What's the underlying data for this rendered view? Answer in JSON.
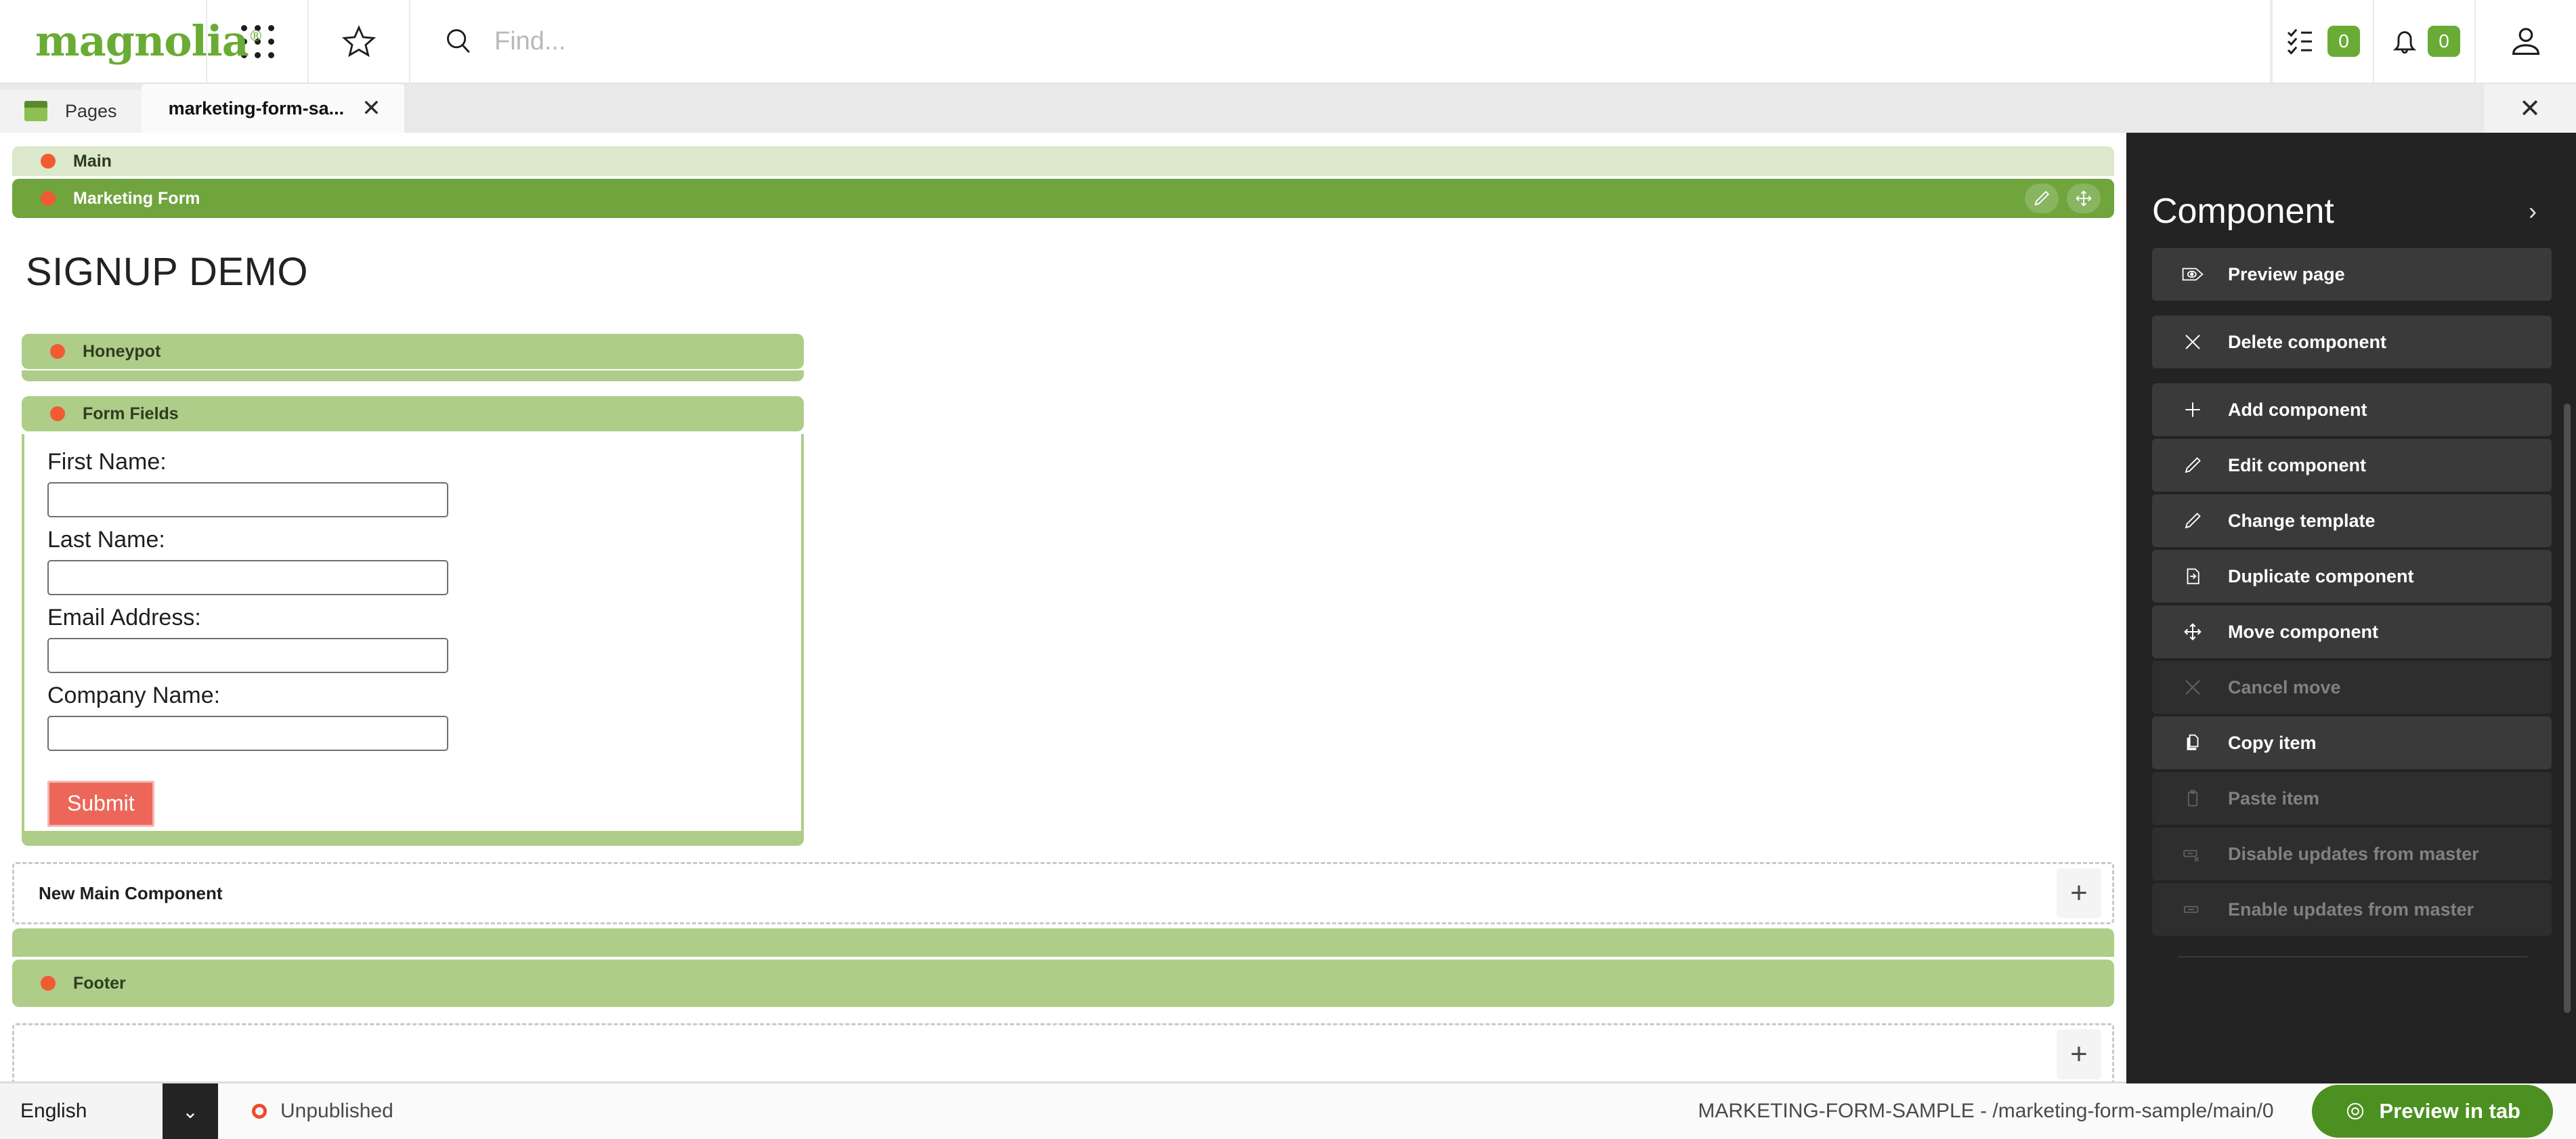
{
  "header": {
    "logo_text": "magnolia",
    "logo_registered": "®",
    "apps_icon": "grid-apps-icon",
    "favorites_icon": "star-icon",
    "search_icon": "search-icon",
    "search_placeholder": "Find...",
    "search_value": "",
    "tasks_icon": "checklist-icon",
    "tasks_count": "0",
    "notifications_icon": "bell-icon",
    "notifications_count": "0",
    "user_icon": "user-avatar-icon",
    "badge_color": "#6aab35"
  },
  "tabs": {
    "pages_tab_label": "Pages",
    "pages_tab_icon": "pages-app-icon",
    "page_tab_label": "marketing-form-sa...",
    "page_tab_close_icon": "close-icon",
    "close_all_icon": "close-icon"
  },
  "editor": {
    "area_main": "Main",
    "component_marketing_form": "Marketing Form",
    "edit_icon": "pencil-icon",
    "move_icon": "move-arrows-icon",
    "page_title": "SIGNUP DEMO",
    "area_honeypot": "Honeypot",
    "area_form_fields": "Form Fields",
    "fields": [
      {
        "label": "First Name:",
        "value": "",
        "name": "first-name"
      },
      {
        "label": "Last Name:",
        "value": "",
        "name": "last-name"
      },
      {
        "label": "Email Address:",
        "value": "",
        "name": "email-address"
      },
      {
        "label": "Company Name:",
        "value": "",
        "name": "company-name"
      }
    ],
    "submit_label": "Submit",
    "submit_color": "#ec6759",
    "new_main_component": "New Main Component",
    "new_main_plus_icon": "plus-icon",
    "area_footer": "Footer",
    "new_footer_plus_icon": "plus-icon",
    "colors": {
      "area_pale": "#dce8cb",
      "component_selected": "#70a43d",
      "area_green": "#aecd88",
      "status_dot": "#f15a33"
    }
  },
  "sidepanel": {
    "title": "Component",
    "collapse_icon": "chevron-right-icon",
    "actions": [
      {
        "label": "Preview page",
        "icon": "preview-eye-tag-icon",
        "disabled": false
      },
      {
        "label": "Delete component",
        "icon": "close-x-icon",
        "disabled": false
      },
      {
        "label": "Add component",
        "icon": "plus-icon",
        "disabled": false
      },
      {
        "label": "Edit component",
        "icon": "pencil-icon",
        "disabled": false
      },
      {
        "label": "Change template",
        "icon": "pencil-icon",
        "disabled": false
      },
      {
        "label": "Duplicate component",
        "icon": "duplicate-icon",
        "disabled": false
      },
      {
        "label": "Move component",
        "icon": "move-arrows-icon",
        "disabled": false
      },
      {
        "label": "Cancel move",
        "icon": "close-x-icon",
        "disabled": true
      },
      {
        "label": "Copy item",
        "icon": "copy-icon",
        "disabled": false
      },
      {
        "label": "Paste item",
        "icon": "clipboard-icon",
        "disabled": true
      },
      {
        "label": "Disable updates from master",
        "icon": "link-off-icon",
        "disabled": true
      },
      {
        "label": "Enable updates from master",
        "icon": "link-icon",
        "disabled": true
      }
    ]
  },
  "statusbar": {
    "language": "English",
    "language_caret_icon": "chevron-down-icon",
    "publication_status": "Unpublished",
    "publication_status_color": "#f1492b",
    "path": "MARKETING-FORM-SAMPLE - /marketing-form-sample/main/0",
    "preview_button_label": "Preview in tab",
    "preview_button_icon": "eye-target-icon",
    "preview_button_color": "#4c9021"
  }
}
